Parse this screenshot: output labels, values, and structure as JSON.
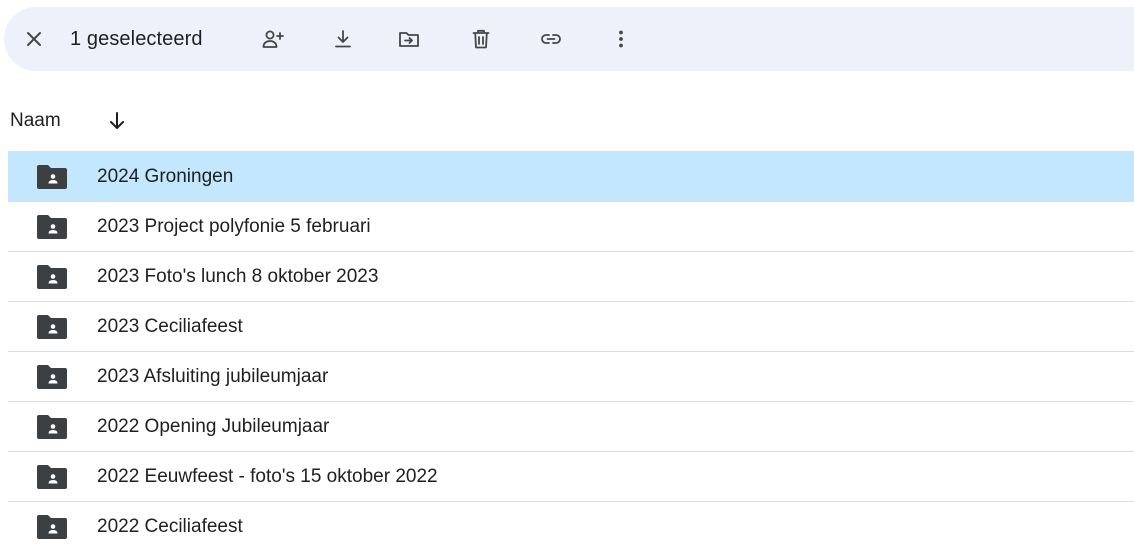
{
  "toolbar": {
    "selection_label": "1 geselecteerd",
    "buttons": [
      {
        "name": "close-icon"
      },
      {
        "name": "share-person-add-icon"
      },
      {
        "name": "download-icon"
      },
      {
        "name": "move-to-folder-icon"
      },
      {
        "name": "trash-icon"
      },
      {
        "name": "link-icon"
      },
      {
        "name": "more-vert-icon"
      }
    ]
  },
  "header": {
    "name_column": "Naam",
    "sort_direction": "descending"
  },
  "files": [
    {
      "name": "2024 Groningen",
      "selected": true,
      "icon": "shared-folder-icon"
    },
    {
      "name": "2023 Project polyfonie 5 februari",
      "selected": false,
      "icon": "shared-folder-icon"
    },
    {
      "name": "2023 Foto's lunch 8 oktober 2023",
      "selected": false,
      "icon": "shared-folder-icon"
    },
    {
      "name": "2023 Ceciliafeest",
      "selected": false,
      "icon": "shared-folder-icon"
    },
    {
      "name": "2023 Afsluiting jubileumjaar",
      "selected": false,
      "icon": "shared-folder-icon"
    },
    {
      "name": "2022 Opening Jubileumjaar",
      "selected": false,
      "icon": "shared-folder-icon"
    },
    {
      "name": "2022 Eeuwfeest - foto's 15 oktober 2022",
      "selected": false,
      "icon": "shared-folder-icon"
    },
    {
      "name": "2022 Ceciliafeest",
      "selected": false,
      "icon": "shared-folder-icon"
    }
  ],
  "colors": {
    "toolbar_bg": "#edf2fa",
    "selected_row": "#c2e7ff",
    "divider": "#dadce0",
    "icon": "#444746",
    "folder": "#3c4043"
  }
}
